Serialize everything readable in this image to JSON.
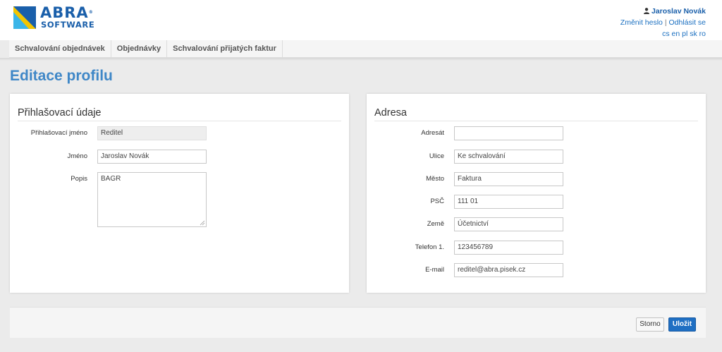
{
  "brand": {
    "name": "ABRA",
    "trademark": "®",
    "subtitle": "SOFTWARE",
    "colors": {
      "primary": "#1a5faa",
      "yellow": "#f2c500",
      "cyan": "#3bb5e8"
    }
  },
  "user": {
    "name": "Jaroslav Novák",
    "change_password": "Změnit heslo",
    "separator": "|",
    "logout": "Odhlásit se",
    "languages": [
      "cs",
      "en",
      "pl",
      "sk",
      "ro"
    ]
  },
  "nav": {
    "items": [
      {
        "label": "Schvalování objednávek"
      },
      {
        "label": "Objednávky"
      },
      {
        "label": "Schvalování přijatých faktur"
      }
    ]
  },
  "page": {
    "title": "Editace profilu"
  },
  "login_panel": {
    "title": "Přihlašovací údaje",
    "fields": {
      "login": {
        "label": "Přihlašovací jméno",
        "value": "Reditel"
      },
      "name": {
        "label": "Jméno",
        "value": "Jaroslav Novák"
      },
      "description": {
        "label": "Popis",
        "value": "BAGR"
      }
    }
  },
  "address_panel": {
    "title": "Adresa",
    "fields": {
      "recipient": {
        "label": "Adresát",
        "value": ""
      },
      "street": {
        "label": "Ulice",
        "value": "Ke schvalování"
      },
      "city": {
        "label": "Město",
        "value": "Faktura"
      },
      "zip": {
        "label": "PSČ",
        "value": "111 01"
      },
      "country": {
        "label": "Země",
        "value": "Účetnictví"
      },
      "phone": {
        "label": "Telefon 1.",
        "value": "123456789"
      },
      "email": {
        "label": "E-mail",
        "value": "reditel@abra.pisek.cz"
      }
    }
  },
  "actions": {
    "cancel": "Storno",
    "save": "Uložit"
  }
}
